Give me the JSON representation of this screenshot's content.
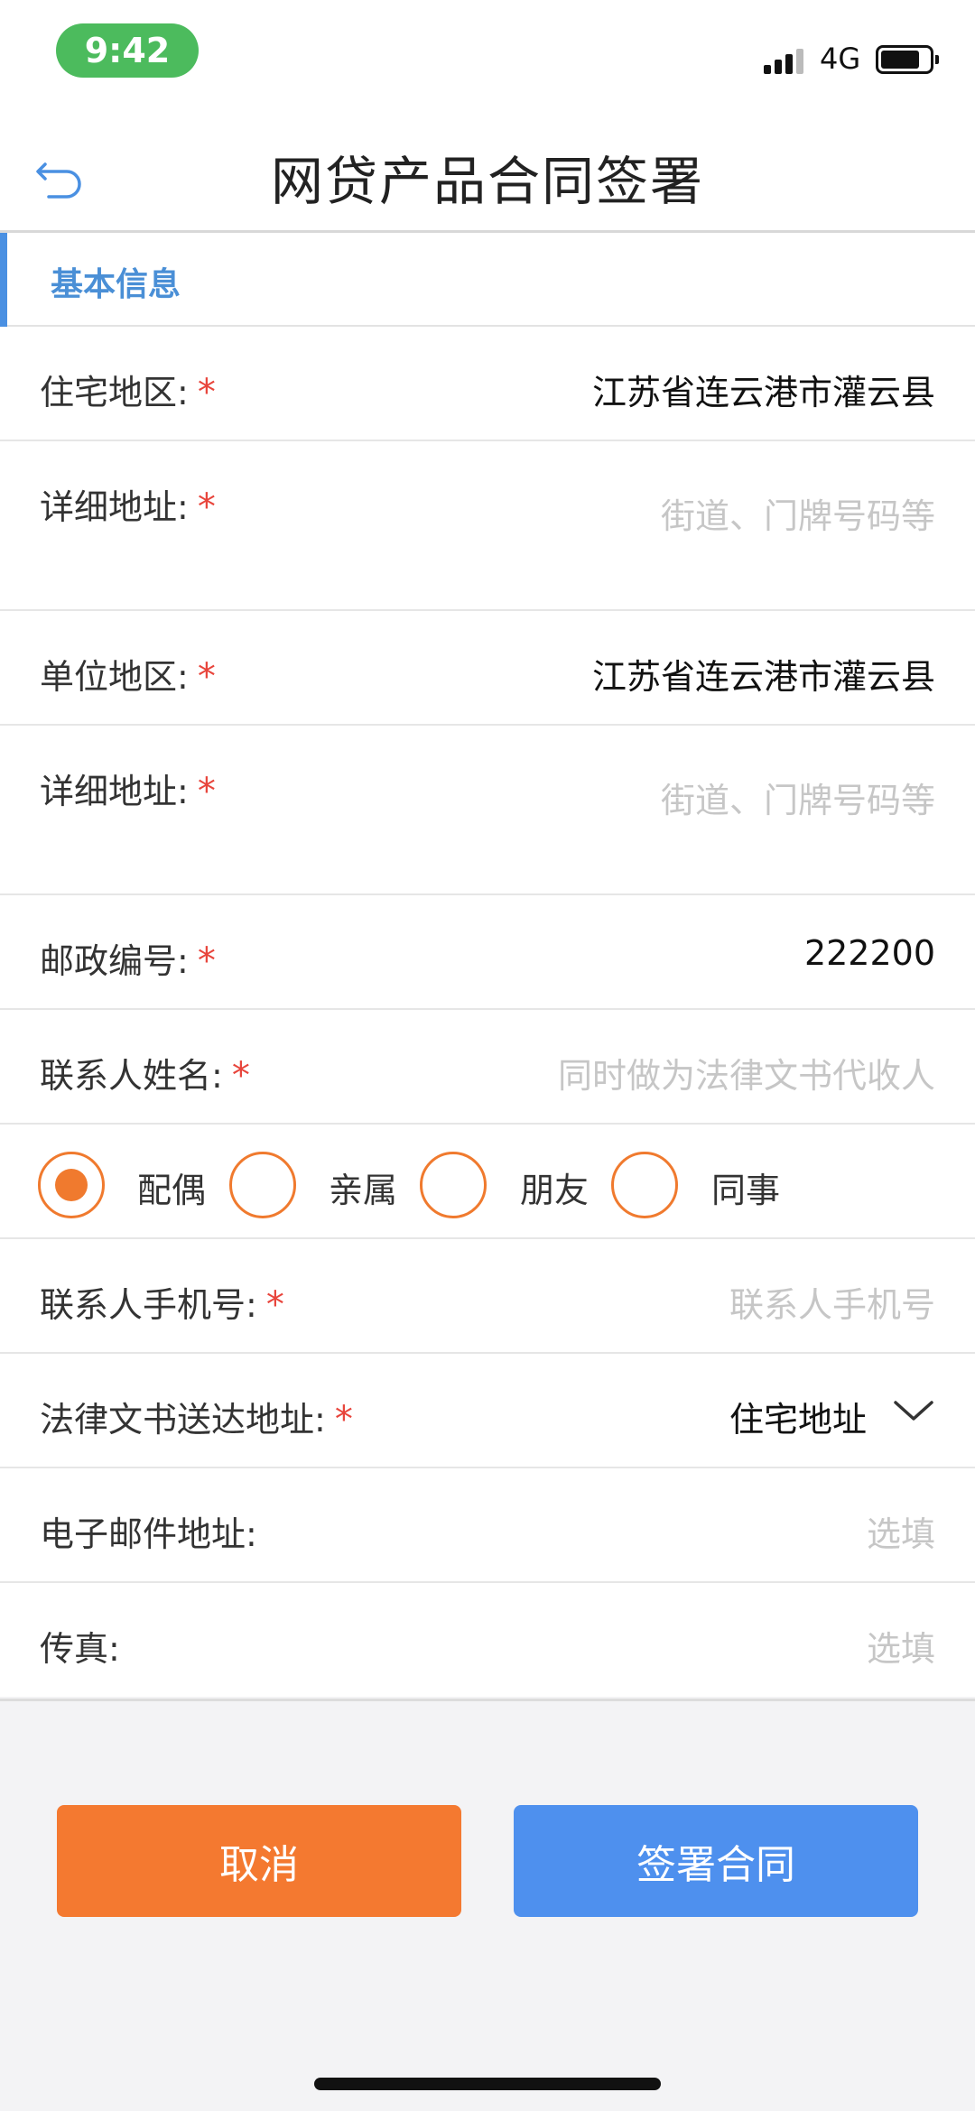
{
  "status_bar": {
    "time": "9:42",
    "network": "4G"
  },
  "nav": {
    "title": "网贷产品合同签署"
  },
  "section": {
    "title": "基本信息"
  },
  "fields": {
    "home_region": {
      "label": "住宅地区:",
      "value": "江苏省连云港市灌云县"
    },
    "home_address": {
      "label": "详细地址:",
      "placeholder": "街道、门牌号码等"
    },
    "work_region": {
      "label": "单位地区:",
      "value": "江苏省连云港市灌云县"
    },
    "work_address": {
      "label": "详细地址:",
      "placeholder": "街道、门牌号码等"
    },
    "postal_code": {
      "label": "邮政编号:",
      "value": "222200"
    },
    "contact_name": {
      "label": "联系人姓名:",
      "placeholder": "同时做为法律文书代收人"
    },
    "relationship": {
      "options": [
        "配偶",
        "亲属",
        "朋友",
        "同事"
      ],
      "selected": "配偶"
    },
    "contact_phone": {
      "label": "联系人手机号:",
      "placeholder": "联系人手机号"
    },
    "legal_address": {
      "label": "法律文书送达地址:",
      "value": "住宅地址"
    },
    "email": {
      "label": "电子邮件地址:",
      "placeholder": "选填"
    },
    "fax": {
      "label": "传真:",
      "placeholder": "选填"
    }
  },
  "required_mark": "*",
  "buttons": {
    "cancel": "取消",
    "sign": "签署合同"
  },
  "colors": {
    "accent_blue": "#4e90ee",
    "accent_orange": "#f47930",
    "required_red": "#e8453c"
  }
}
